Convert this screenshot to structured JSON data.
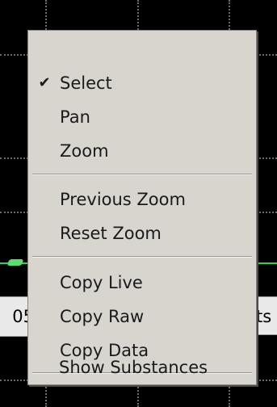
{
  "background": {
    "axis_left_text": "05",
    "axis_right_text": "ts",
    "trace_color": "#2fd05a"
  },
  "menu": {
    "items": [
      {
        "label": "Select",
        "checked": true,
        "check_icon": "checkmark-icon"
      },
      {
        "label": "Pan",
        "checked": false
      },
      {
        "label": "Zoom",
        "checked": false
      },
      {
        "label": "Previous Zoom",
        "checked": false
      },
      {
        "label": "Reset Zoom",
        "checked": false
      },
      {
        "label": "Copy Live",
        "checked": false
      },
      {
        "label": "Copy Raw",
        "checked": false
      },
      {
        "label": "Copy Data",
        "checked": false
      },
      {
        "label": "Show Substances",
        "checked": false
      }
    ],
    "colors": {
      "background": "#d8d5cf",
      "text": "#1a1a1a"
    }
  }
}
